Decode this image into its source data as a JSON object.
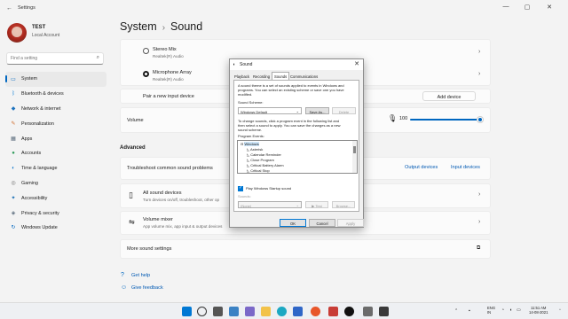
{
  "window": {
    "title": "Settings",
    "back_glyph": "←",
    "min": "—",
    "max": "▢",
    "close": "✕"
  },
  "profile": {
    "name": "TEST",
    "type": "Local Account"
  },
  "search": {
    "placeholder": "Find a setting",
    "icon": "search-icon"
  },
  "nav": [
    {
      "label": "System",
      "icon": "system-icon",
      "glyph": "▭",
      "color": "#0067c0",
      "active": true
    },
    {
      "label": "Bluetooth & devices",
      "icon": "bluetooth-icon",
      "glyph": "ᛒ",
      "color": "#0078d4"
    },
    {
      "label": "Network & internet",
      "icon": "wifi-icon",
      "glyph": "◆",
      "color": "#1e73be"
    },
    {
      "label": "Personalization",
      "icon": "brush-icon",
      "glyph": "✎",
      "color": "#d06c2c"
    },
    {
      "label": "Apps",
      "icon": "apps-icon",
      "glyph": "▦",
      "color": "#5a6b7c"
    },
    {
      "label": "Accounts",
      "icon": "person-icon",
      "glyph": "●",
      "color": "#2e9b5a"
    },
    {
      "label": "Time & language",
      "icon": "globe-icon",
      "glyph": "◐",
      "color": "#1f7fcf"
    },
    {
      "label": "Gaming",
      "icon": "gamepad-icon",
      "glyph": "◎",
      "color": "#707070"
    },
    {
      "label": "Accessibility",
      "icon": "accessibility-icon",
      "glyph": "✦",
      "color": "#1a6fb5"
    },
    {
      "label": "Privacy & security",
      "icon": "shield-icon",
      "glyph": "◈",
      "color": "#5a6b7c"
    },
    {
      "label": "Windows Update",
      "icon": "update-icon",
      "glyph": "↻",
      "color": "#0067c0"
    }
  ],
  "breadcrumb": {
    "parent": "System",
    "sep": "›",
    "current": "Sound"
  },
  "inputs": [
    {
      "name": "Stereo Mix",
      "sub": "Realtek(R) Audio",
      "selected": false
    },
    {
      "name": "Microphone Array",
      "sub": "Realtek(R) Audio",
      "selected": true
    }
  ],
  "pair": {
    "label": "Pair a new input device",
    "button": "Add device"
  },
  "volume": {
    "label": "Volume",
    "value": "100",
    "level": 100
  },
  "advanced": {
    "heading": "Advanced",
    "troubleshoot": {
      "label": "Troubleshoot common sound problems",
      "output": "Output devices",
      "input": "Input devices"
    },
    "all_devices": {
      "title": "All sound devices",
      "sub": "Turn devices on/off, troubleshoot, other op"
    },
    "mixer": {
      "title": "Volume mixer",
      "sub": "App volume mix, app input & output devices"
    },
    "more": {
      "label": "More sound settings"
    }
  },
  "help": {
    "get_help": "Get help",
    "feedback": "Give feedback"
  },
  "dialog": {
    "title": "Sound",
    "tabs": [
      "Playback",
      "Recording",
      "Sounds",
      "Communications"
    ],
    "active_tab": "Sounds",
    "intro": [
      "A sound theme is a set of sounds applied to events in Windows and",
      "programs.  You can select an existing scheme or save one you have",
      "modified."
    ],
    "scheme_label": "Sound Scheme:",
    "scheme_value": "Windows Default",
    "save_as": "Save As...",
    "delete": "Delete",
    "instr": [
      "To change sounds, click a program event in the following list and",
      "then select a sound to apply.  You can save the changes as a new",
      "sound scheme."
    ],
    "events_label": "Program Events:",
    "events": [
      "Windows",
      "Asterisk",
      "Calendar Reminder",
      "Close Program",
      "Critical Battery Alarm",
      "Critical Stop"
    ],
    "startup_label": "Play Windows Startup sound",
    "sounds_label": "Sounds:",
    "sound_value": "(None)",
    "test": "▶ Test",
    "browse": "Browse...",
    "ok": "OK",
    "cancel": "Cancel",
    "apply": "Apply"
  },
  "taskbar": {
    "lang1": "ENG",
    "lang2": "IN",
    "time": "11:51 AM",
    "date": "14-08-2021"
  }
}
